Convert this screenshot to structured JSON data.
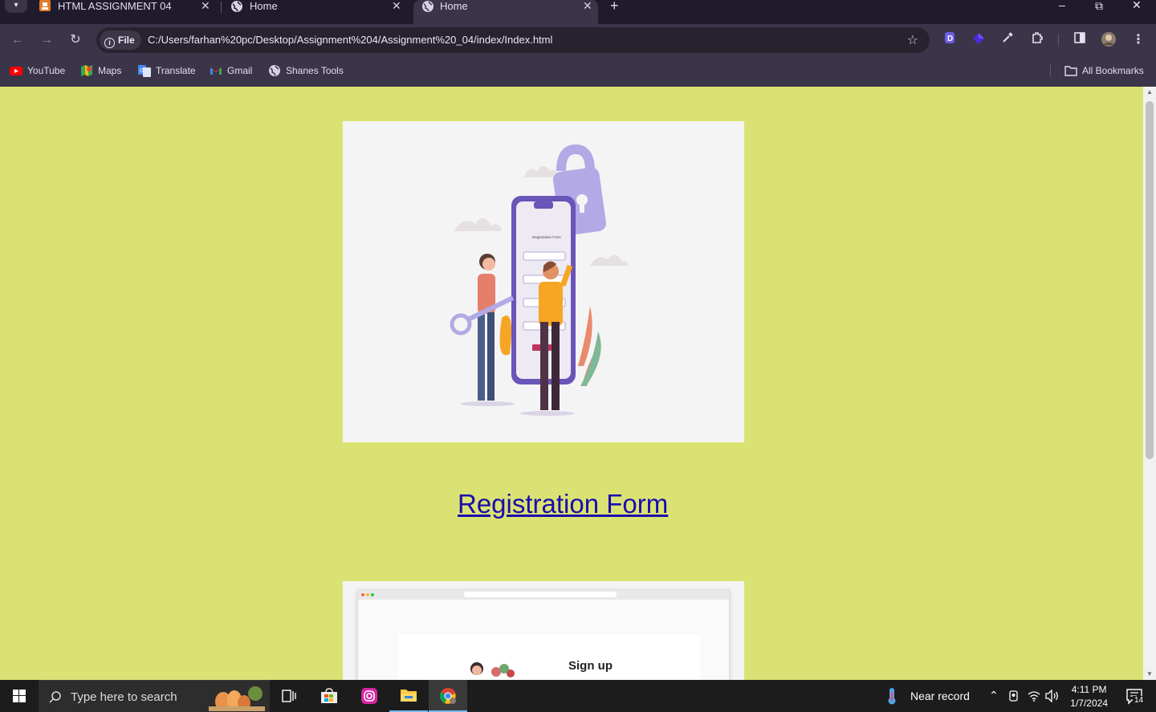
{
  "browser": {
    "tabs": [
      {
        "title": "HTML ASSIGNMENT 04",
        "icon": "html-file-icon",
        "active": false
      },
      {
        "title": "Home",
        "icon": "globe-icon",
        "active": false
      },
      {
        "title": "Home",
        "icon": "globe-icon",
        "active": true
      }
    ],
    "address_chip": "File",
    "url": "C:/Users/farhan%20pc/Desktop/Assignment%204/Assignment%20_04/index/Index.html",
    "bookmarks": [
      {
        "label": "YouTube",
        "icon": "youtube-icon"
      },
      {
        "label": "Maps",
        "icon": "maps-icon"
      },
      {
        "label": "Translate",
        "icon": "translate-icon"
      },
      {
        "label": "Gmail",
        "icon": "gmail-icon"
      },
      {
        "label": "Shanes Tools",
        "icon": "globe-icon"
      }
    ],
    "all_bookmarks": "All Bookmarks"
  },
  "page": {
    "hero_image": "registration-illustration",
    "link_text": "Registration Form",
    "second_image_heading": "Sign up",
    "background": "#dbe274"
  },
  "taskbar": {
    "search_placeholder": "Type here to search",
    "weather": "Near record",
    "time": "4:11 PM",
    "date": "1/7/2024",
    "notifications": "14"
  }
}
